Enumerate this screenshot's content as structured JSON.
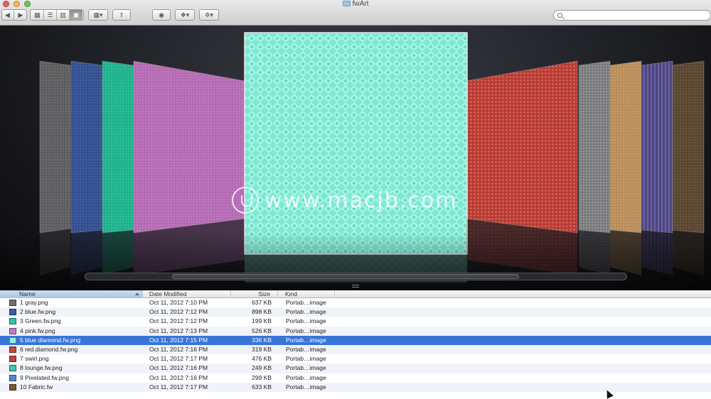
{
  "window": {
    "title": "fwArt"
  },
  "toolbar": {
    "search_placeholder": "",
    "icons": [
      "back-arrow-icon",
      "forward-arrow-icon",
      "icon-view-icon",
      "list-view-icon",
      "column-view-icon",
      "coverflow-view-icon",
      "arrange-icon",
      "share-icon",
      "quicklook-eye-icon",
      "dropbox-icon",
      "gear-icon"
    ]
  },
  "watermark": {
    "text": "www.macjb.com"
  },
  "columns": {
    "name": "Name",
    "date": "Date Modified",
    "size": "Size",
    "kind": "Kind"
  },
  "files": [
    {
      "name": "1 gray.png",
      "date": "Oct 11, 2012 7:10 PM",
      "size": "637 KB",
      "kind": "Portab…image",
      "color": "#707070"
    },
    {
      "name": "2 blue.fw.png",
      "date": "Oct 11, 2012 7:12 PM",
      "size": "898 KB",
      "kind": "Portab…image",
      "color": "#3c5ca8"
    },
    {
      "name": "3 Green.fw.png",
      "date": "Oct 11, 2012 7:12 PM",
      "size": "199 KB",
      "kind": "Portab…image",
      "color": "#2fc6a0"
    },
    {
      "name": "4 pink.fw.png",
      "date": "Oct 11, 2012 7:13 PM",
      "size": "526 KB",
      "kind": "Portab…image",
      "color": "#c77ac6"
    },
    {
      "name": "5 blue diamond.fw.png",
      "date": "Oct 11, 2012 7:15 PM",
      "size": "336 KB",
      "kind": "Portab…image",
      "color": "#8ff3dd",
      "selected": true
    },
    {
      "name": "6 red diamond.fw.png",
      "date": "Oct 11, 2012 7:16 PM",
      "size": "319 KB",
      "kind": "Portab…image",
      "color": "#c8463d"
    },
    {
      "name": "7 swirl.png",
      "date": "Oct 11, 2012 7:17 PM",
      "size": "476 KB",
      "kind": "Portab…image",
      "color": "#b54a3c"
    },
    {
      "name": "8 lounge.fw.png",
      "date": "Oct 11, 2012 7:16 PM",
      "size": "249 KB",
      "kind": "Portab…image",
      "color": "#44c4a8"
    },
    {
      "name": "9 Pixelated.fw.png",
      "date": "Oct 11, 2012 7:16 PM",
      "size": "299 KB",
      "kind": "Portab…image",
      "color": "#5a86c8"
    },
    {
      "name": "10 Fabric.fw",
      "date": "Oct 11, 2012 7:17 PM",
      "size": "633 KB",
      "kind": "Portab…image",
      "color": "#7a5a38"
    }
  ]
}
